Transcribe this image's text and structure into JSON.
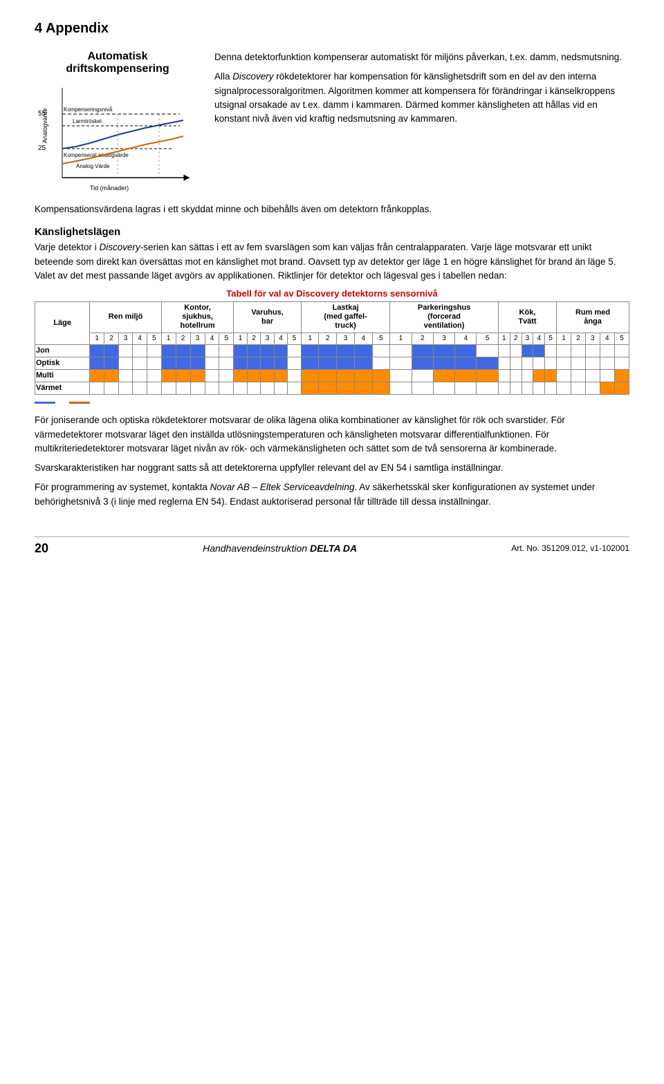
{
  "page": {
    "header": "4 Appendix",
    "chart_title": "Automatisk driftskompensering",
    "kompenseringsniva_label": "Kompenseringsnivå",
    "larmtroskel_label": "Larmtröskel",
    "analog_varde_label": "Analog Värde",
    "kompenserat_label": "Kompenserat analogvärde",
    "tid_label": "Tid (månader)",
    "y_label": "Analogvärde",
    "y_top": "55",
    "y_bottom": "25",
    "right_para1": "Denna detektorfunktion kompenserar automatiskt för miljöns påverkan, t.ex. damm, nedsmutsning.",
    "right_para2": "Alla Discovery rökdetektorer har kompensation för känslighetsdrift som en del av den interna signalprocessoralgoritmen. Algoritmen kommer att kompensera för förändringar i känselkroppens utsignal orsakade av t.ex. damm i kammaren. Därmed kommer känsligheten att hållas vid en konstant nivå även vid kraftig nedsmutsning av kammaren.",
    "para_kompensation": "Kompensationsvärdena lagras i ett skyddat minne och bibehålls även om detektorn frånkopplas.",
    "heading_kanslighet": "Känslighetslägen",
    "para_kanslighet1": "Varje detektor i Discovery-serien kan sättas i ett av fem svarslägen som kan väljas från centralapparaten. Varje läge motsvarar ett unikt beteende som direkt kan översättas mot en känslighet mot brand. Oavsett typ av detektor ger läge 1 en högre känslighet för brand än läge 5. Valet av det mest passande läget avgörs av applikationen. Riktlinjer för detektor och lägesval ges i tabellen nedan:",
    "table_title": "Tabell för val av Discovery detektorns sensornivå",
    "table_headers": [
      {
        "label": "Ren miljö",
        "span": 5
      },
      {
        "label": "Kontor,\nsjukhus,\nhotellrum",
        "span": 5
      },
      {
        "label": "Varuhus,\nbar",
        "span": 5
      },
      {
        "label": "Lastkaj\n(med gaffel-\ntruck)",
        "span": 5
      },
      {
        "label": "Parkeringshus\n(forcerad\nventilation)",
        "span": 5
      },
      {
        "label": "Kök,\nTvätt",
        "span": 5
      },
      {
        "label": "Rum med\nånga",
        "span": 5
      }
    ],
    "lage_label": "Läge",
    "row_labels": [
      "Jon",
      "Optisk",
      "Multi",
      "Värmet"
    ],
    "para_jon": "För joniserande och optiska rökdetektorer motsvarar de olika lägena olika kombinationer av känslighet för rök och svarstider. För värmedetektorer motsvarar läget den inställda utlösningstemperaturen och känsligheten motsvarar differentialfunktionen. För multikriteriedetektorer motsvarar läget nivån av rök- och värmekänsligheten och sättet som de två sensorerna är kombinerade.",
    "para_svar": "Svarskarakteristiken har noggrant satts så att detektorerna uppfyller relevant del av EN 54 i samtliga inställningar.",
    "para_prog": "För programmering av systemet, kontakta Novar AB – Eltek Serviceavdelning. Av säkerhetsskäl sker konfigurationen av systemet under behörighetsnivå 3 (i linje med reglerna EN 54). Endast auktoriserad personal får tillträde till dessa inställningar.",
    "footer_page": "20",
    "footer_title": "Handhavendeinstruktion DELTA DA",
    "footer_artno": "Art. No. 351209.012, v1-102001"
  }
}
